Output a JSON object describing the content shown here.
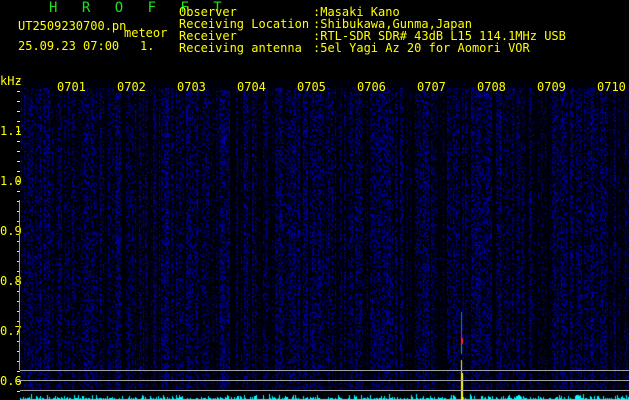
{
  "app": {
    "title": "H R O F F T"
  },
  "file": {
    "name": "UT2509230700.pn",
    "mode": "meteor",
    "datetime": "25.09.23 07:00",
    "page": "1."
  },
  "info": [
    {
      "label": "Receiving antenna",
      "value": ":5el Yagi Az 20 for Aomori VOR"
    },
    {
      "label": "Observer",
      "value": ":Masaki Kano"
    },
    {
      "label": "Receiving Location",
      "value": ":Shibukawa,Gunma,Japan"
    },
    {
      "label": "Receiver",
      "value": ":RTL-SDR SDR# 43dB L15 114.1MHz USB"
    }
  ],
  "spectrogram": {
    "unit": "kHz",
    "freq_labels": [
      "1.1",
      "1.0",
      "0.9",
      "0.8",
      "0.7",
      "0.6"
    ],
    "time_labels": [
      "0701",
      "0702",
      "0703",
      "0704",
      "0705",
      "0706",
      "0707",
      "0708",
      "0709",
      "0710"
    ],
    "colors": {
      "noise": "#1010c0",
      "meteor": "#ffff00",
      "spectrum": "#00ffff",
      "labels": "#ffff00",
      "title": "#20e020"
    }
  }
}
